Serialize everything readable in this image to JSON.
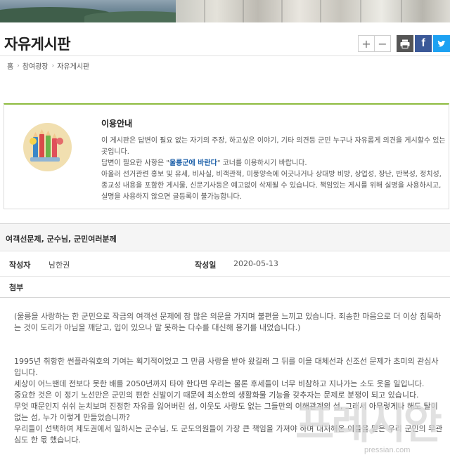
{
  "page": {
    "title": "자유게시판"
  },
  "toolbar": {
    "zoom_in": "+",
    "zoom_out": "−",
    "print_icon": "printer-icon",
    "facebook_label": "f",
    "twitter_icon": "twitter-icon"
  },
  "breadcrumb": {
    "home": "홈",
    "level1": "참여광장",
    "level2": "자유게시판"
  },
  "guide": {
    "title": "이용안내",
    "para1": "이 게시판은 답변이 필요 없는 자기의 주장, 하고싶은 이야기, 기타 의견등 군민 누구나 자유롭게 의견을 게시할수 있는 곳입니다.",
    "para2_before": "답변이 필요한 사항은 \"",
    "para2_highlight": "울릉군에 바란다",
    "para2_after": "\" 코너를 이용하시기 바랍니다.",
    "para3": "아울러 선거관련 홍보 및 유세, 비사실, 비객관적, 미풍양속에 어긋나거나 상대방 비방, 상업성, 장난, 반복성, 정치성, 종교성 내용을 포함한 게시물, 신문기사등은 예고없이 삭제될 수 있습니다. 책임있는 게시를 위해 실명을 사용하시고, 실명을 사용하지 않으면 글등록이 불가능합니다."
  },
  "post": {
    "title": "여객선문제, 군수님, 군민여러분께",
    "author_label": "작성자",
    "author": "남한권",
    "date_label": "작성일",
    "date": "2020-05-13",
    "attach_label": "첨부"
  },
  "content": {
    "p1": "(울릉을 사랑하는 한 군민으로 작금의 여객선 문제에 참 많은 의문을 가지며 불편을 느끼고 있습니다. 죄송한 마음으로 더 이상 침묵하는 것이 도리가 아님을 깨닫고, 입이 있으나 말 못하는 다수를 대신해 용기를 내었습니다.)",
    "p2": "1995년 취항한 썬플라워호의 기여는 획기적이었고 그 만큼 사랑을 받아 왔길래 그 뒤를 이을 대체선과 신조선 문제가 초미의 관심사입니다.",
    "p3": "세상이 어느땐데 전보다 못한 배를 2050년까지 타야 한다면 우리는 물론 후세들이 너무 비참하고 지나가는 소도 웃을 일입니다.",
    "p4": "중요한 것은 이 정기 노선만은 군민의 편한 신발이기 때문에 최소한의 생활화물 기능을 갖추자는 문제로 분쟁이 되고 있습니다.",
    "p5": "무엇 때문인지 쉬쉬 눈치보며 진정한 자유를 잃어버린 섬, 이웃도 사랑도 없는 그들만의 이해관계의 섬, 그래서 아무렇게나 해도 탈이 없는 섬, 누가 이렇게 만들었습니까?",
    "p6": "우리들이 선택하여 제도권에서 일하시는 군수님, 도 군도의원들이 가장 큰 책임을 가져야 하며 대처해온 이들을 믿은 우리 군민의 무관심도 한 몫 했습니다."
  },
  "watermark": {
    "big": "프레시안",
    "small": "pressian.com"
  }
}
